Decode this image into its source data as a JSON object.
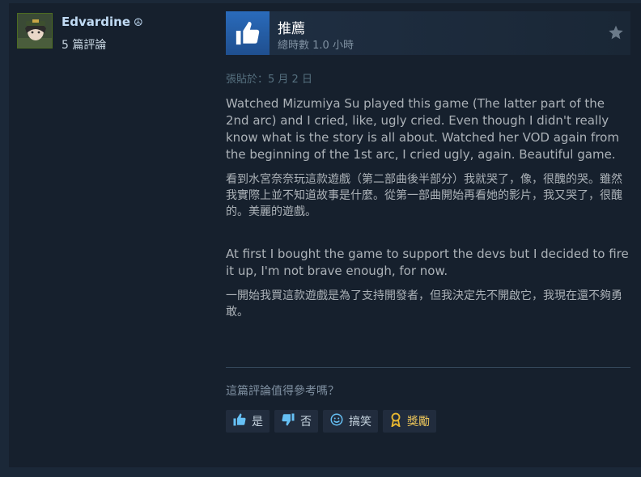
{
  "author": {
    "name": "Edvardine",
    "badge_icon": "peace-icon",
    "review_count": "5 篇評論"
  },
  "review": {
    "verdict": "推薦",
    "hours": "總時數 1.0 小時",
    "posted": "張貼於：5 月 2 日",
    "paragraphs": [
      "Watched Mizumiya Su played this game (The latter part of the 2nd arc) and I cried, like, ugly cried. Even though I didn't really know what is the story is all about. Watched her VOD again from the beginning of the 1st arc, I cried ugly, again. Beautiful game.",
      "看到水宮奈奈玩這款遊戲（第二部曲後半部分）我就哭了，像，很醜的哭。雖然我實際上並不知道故事是什麼。從第一部曲開始再看她的影片，我又哭了，很醜的。美麗的遊戲。",
      "At first I bought the game to support the devs but I decided to fire it up, I'm not brave enough, for now.",
      "一開始我買這款遊戲是為了支持開發者，但我決定先不開啟它，我現在還不夠勇敢。"
    ]
  },
  "helpful": {
    "question": "這篇評論值得參考嗎？",
    "yes": "是",
    "no": "否",
    "funny": "搞笑",
    "award": "獎勵"
  },
  "colors": {
    "background": "#1b2838",
    "card": "#16202d",
    "accent": "#66c0f4",
    "thumb": "#2a6bbb"
  }
}
